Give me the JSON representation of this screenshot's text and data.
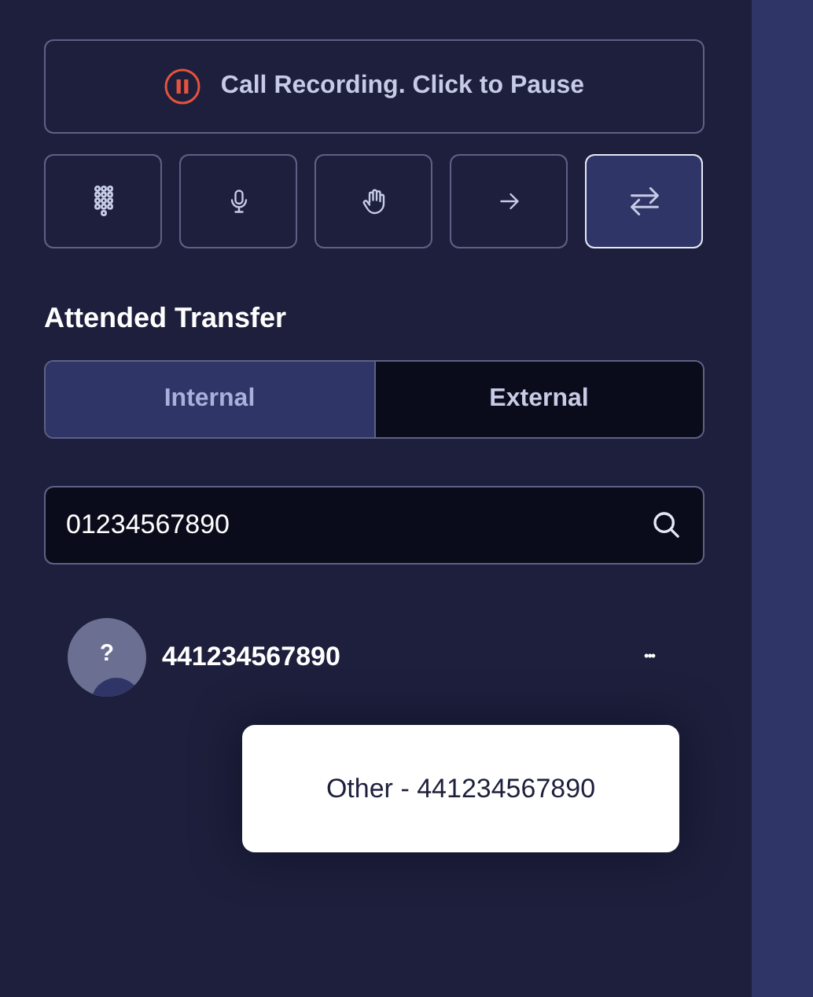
{
  "recording": {
    "label": "Call Recording. Click to Pause",
    "recording": true
  },
  "actions": [
    {
      "kind": "keypad",
      "selected": false
    },
    {
      "kind": "mic",
      "selected": false
    },
    {
      "kind": "hold",
      "selected": false
    },
    {
      "kind": "forward",
      "selected": false
    },
    {
      "kind": "transfer",
      "selected": true
    }
  ],
  "section_title": "Attended Transfer",
  "tabs": [
    {
      "label": "Internal",
      "selected": true
    },
    {
      "label": "External",
      "selected": false
    }
  ],
  "search": {
    "value": "01234567890"
  },
  "contact": {
    "avatar": "?",
    "number": "441234567890",
    "more": "•••"
  },
  "tooltip": "Other - 441234567890"
}
